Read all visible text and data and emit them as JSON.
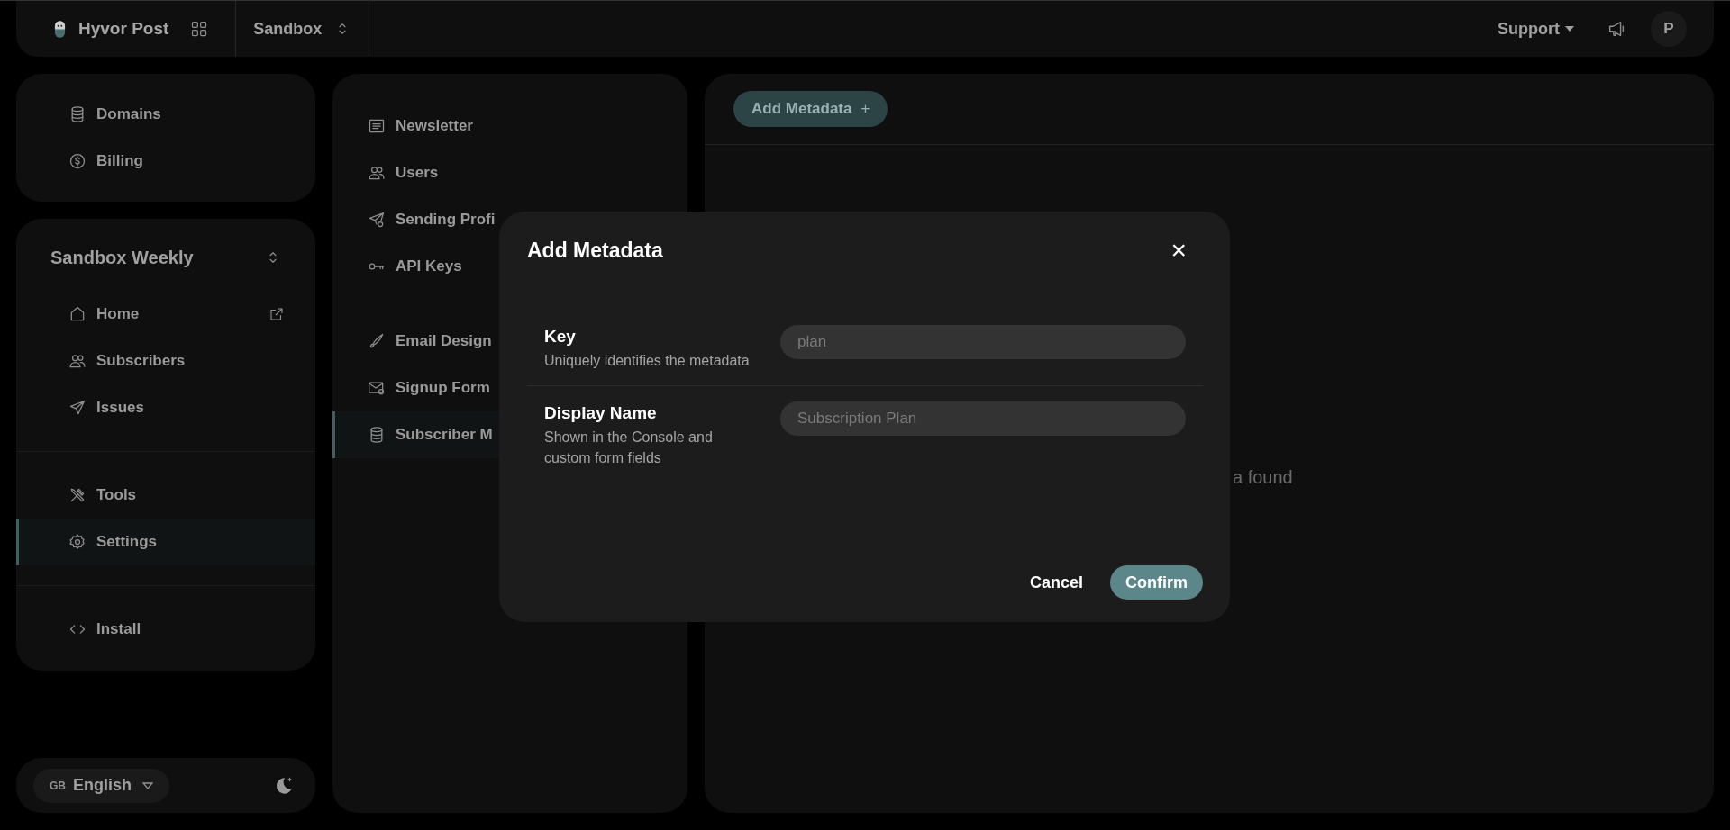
{
  "topbar": {
    "brand": "Hyvor Post",
    "project": "Sandbox",
    "support": "Support",
    "avatar": "P"
  },
  "sidebar": {
    "top_items": [
      {
        "label": "Domains",
        "selected": false
      },
      {
        "label": "Billing",
        "selected": false
      }
    ],
    "newsletter": "Sandbox Weekly",
    "nav_groups": [
      [
        {
          "label": "Home",
          "selected": false
        },
        {
          "label": "Subscribers",
          "selected": false
        },
        {
          "label": "Issues",
          "selected": false
        }
      ],
      [
        {
          "label": "Tools",
          "selected": false
        },
        {
          "label": "Settings",
          "selected": true
        }
      ],
      [
        {
          "label": "Install",
          "selected": false
        }
      ]
    ],
    "language": {
      "flag": "GB",
      "label": "English"
    }
  },
  "settings_menu": [
    [
      {
        "label": "Newsletter",
        "selected": false
      },
      {
        "label": "Users",
        "selected": false
      },
      {
        "label": "Sending Profi",
        "selected": false
      },
      {
        "label": "API Keys",
        "selected": false
      }
    ],
    [
      {
        "label": "Email Design",
        "selected": false
      },
      {
        "label": "Signup Form",
        "selected": false
      },
      {
        "label": "Subscriber M",
        "selected": true
      }
    ]
  ],
  "main": {
    "add_button": "Add Metadata",
    "add_symbol": "+",
    "empty_text": "a found"
  },
  "modal": {
    "title": "Add Metadata",
    "close": "×",
    "fields": [
      {
        "label": "Key",
        "description": "Uniquely identifies the metadata",
        "placeholder": "plan"
      },
      {
        "label": "Display Name",
        "description": "Shown in the Console and custom form fields",
        "placeholder": "Subscription Plan"
      }
    ],
    "cancel": "Cancel",
    "confirm": "Confirm"
  }
}
